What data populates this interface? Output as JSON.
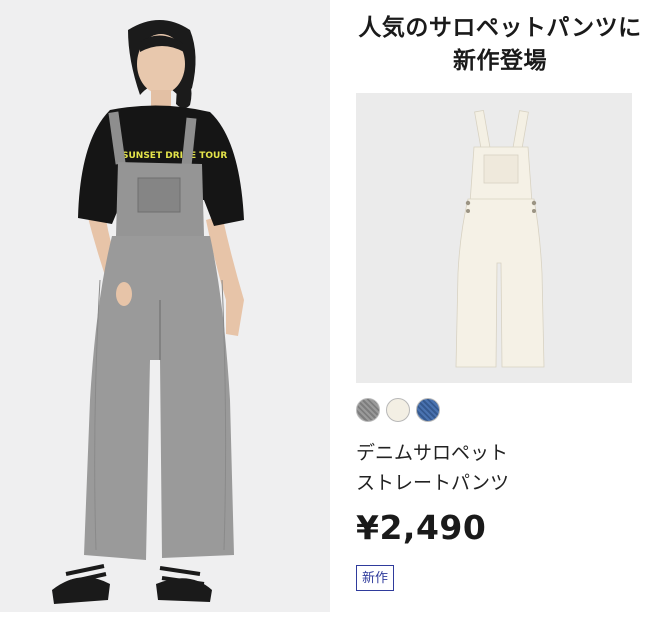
{
  "promo": {
    "headline_line1": "人気のサロペットパンツに",
    "headline_line2": "新作登場",
    "model_shirt_print": "SUNSET DRIVE TOUR"
  },
  "product": {
    "name_line1": "デニムサロペット",
    "name_line2": "ストレートパンツ",
    "price": "¥2,490",
    "badge": "新作",
    "swatches": [
      {
        "name": "gray",
        "color": "#8d8d8d"
      },
      {
        "name": "off-white",
        "color": "#f3efe4"
      },
      {
        "name": "blue",
        "color": "#3f68a6"
      }
    ]
  },
  "colors": {
    "badge": "#2f3b9c",
    "model_background": "#eeeeef",
    "product_background": "#ebebeb"
  }
}
